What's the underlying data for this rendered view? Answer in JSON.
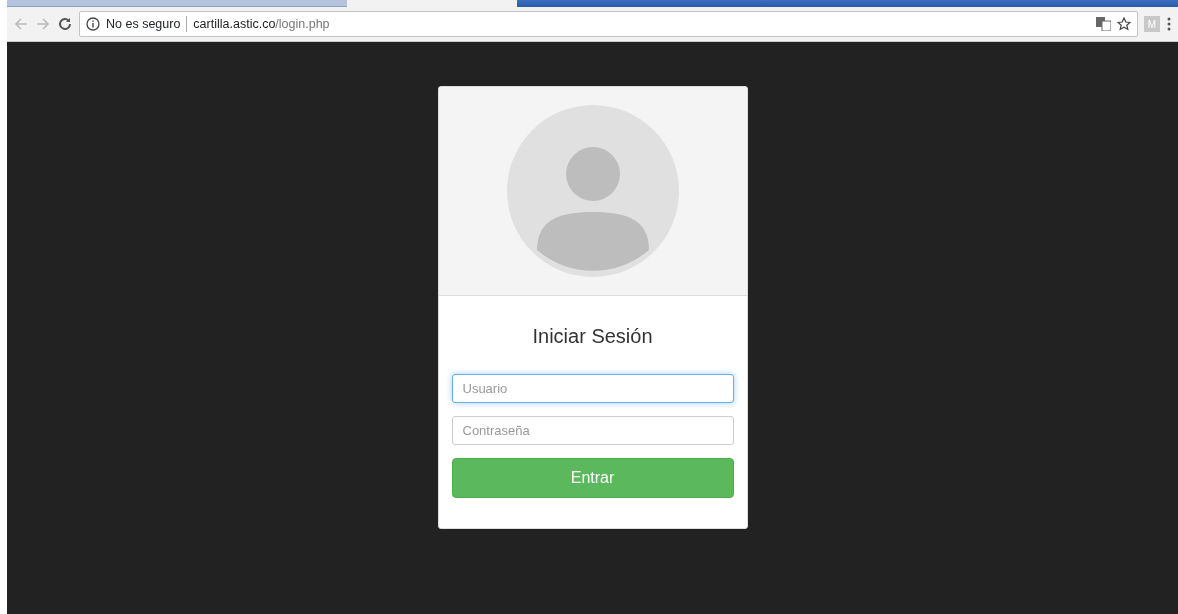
{
  "browser": {
    "security_label": "No es seguro",
    "url_host": "cartilla.astic.co",
    "url_path": "/login.php",
    "extension_label": "M"
  },
  "login": {
    "title": "Iniciar Sesión",
    "fields": [
      {
        "placeholder": "Usuario",
        "focused": true
      },
      {
        "placeholder": "Contraseña",
        "focused": false
      }
    ],
    "submit": "Entrar"
  }
}
